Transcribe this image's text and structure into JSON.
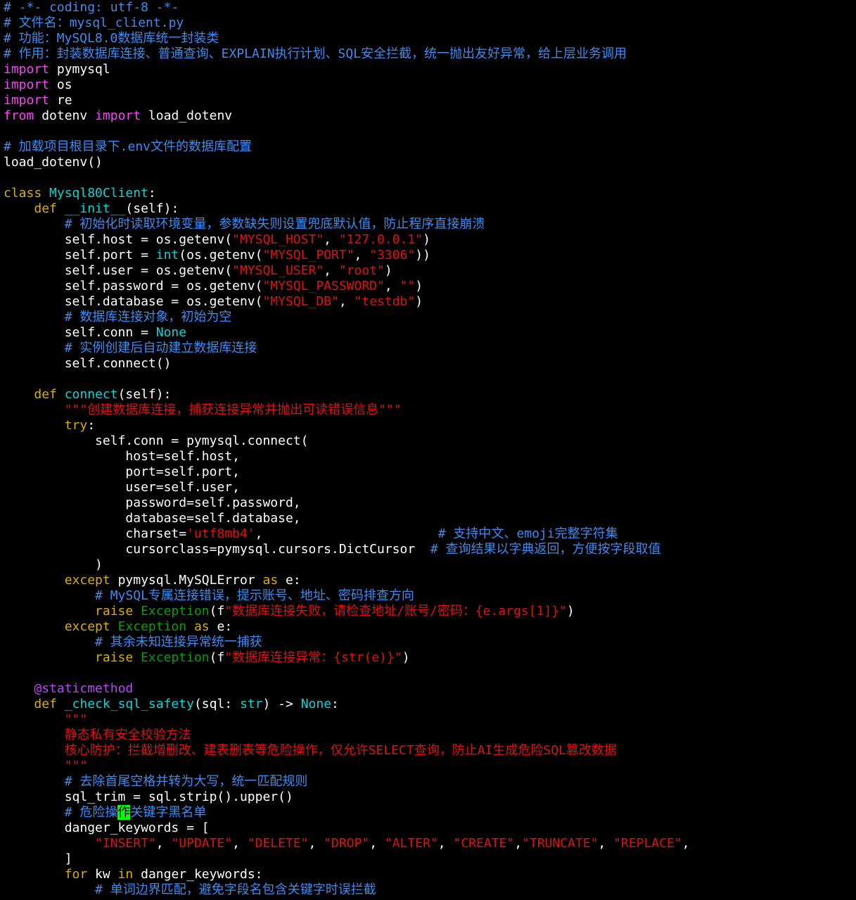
{
  "editor": {
    "lines": [
      [
        [
          "comment",
          "# -*- coding: utf-8 -*-"
        ]
      ],
      [
        [
          "comment",
          "# 文件名："
        ],
        [
          "comment",
          "mysql_client.py"
        ]
      ],
      [
        [
          "comment",
          "# 功能：MySQL8.0数据库统一封装类"
        ]
      ],
      [
        [
          "comment",
          "# 作用：封装数据库连接、普通查询、EXPLAIN执行计划、SQL安全拦截，统一抛出友好异常，给上层业务调用"
        ]
      ],
      [
        [
          "kw",
          "import"
        ],
        [
          "plain",
          " pymysql"
        ]
      ],
      [
        [
          "kw",
          "import"
        ],
        [
          "plain",
          " os"
        ]
      ],
      [
        [
          "kw",
          "import"
        ],
        [
          "plain",
          " re"
        ]
      ],
      [
        [
          "kw",
          "from"
        ],
        [
          "plain",
          " dotenv "
        ],
        [
          "kw",
          "import"
        ],
        [
          "plain",
          " load_dotenv"
        ]
      ],
      [],
      [
        [
          "comment",
          "# 加载项目根目录下.env文件的数据库配置"
        ]
      ],
      [
        [
          "plain",
          "load_dotenv()"
        ]
      ],
      [],
      [
        [
          "def",
          "class"
        ],
        [
          "plain",
          " "
        ],
        [
          "fn",
          "Mysql80Client"
        ],
        [
          "plain",
          ":"
        ]
      ],
      [
        [
          "plain",
          "    "
        ],
        [
          "def",
          "def"
        ],
        [
          "plain",
          " "
        ],
        [
          "fn",
          "__init__"
        ],
        [
          "plain",
          "(self):"
        ]
      ],
      [
        [
          "plain",
          "        "
        ],
        [
          "comment",
          "# 初始化时读取环境变量，参数缺失则设置兜底默认值，防止程序直接崩溃"
        ]
      ],
      [
        [
          "plain",
          "        self.host = os.getenv("
        ],
        [
          "str",
          "\"MYSQL_HOST\""
        ],
        [
          "plain",
          ", "
        ],
        [
          "str",
          "\"127.0.0.1\""
        ],
        [
          "plain",
          ")"
        ]
      ],
      [
        [
          "plain",
          "        self.port = "
        ],
        [
          "fn",
          "int"
        ],
        [
          "plain",
          "(os.getenv("
        ],
        [
          "str",
          "\"MYSQL_PORT\""
        ],
        [
          "plain",
          ", "
        ],
        [
          "str",
          "\"3306\""
        ],
        [
          "plain",
          "))"
        ]
      ],
      [
        [
          "plain",
          "        self.user = os.getenv("
        ],
        [
          "str",
          "\"MYSQL_USER\""
        ],
        [
          "plain",
          ", "
        ],
        [
          "str",
          "\"root\""
        ],
        [
          "plain",
          ")"
        ]
      ],
      [
        [
          "plain",
          "        self.password = os.getenv("
        ],
        [
          "str",
          "\"MYSQL_PASSWORD\""
        ],
        [
          "plain",
          ", "
        ],
        [
          "str",
          "\"\""
        ],
        [
          "plain",
          ")"
        ]
      ],
      [
        [
          "plain",
          "        self.database = os.getenv("
        ],
        [
          "str",
          "\"MYSQL_DB\""
        ],
        [
          "plain",
          ", "
        ],
        [
          "str",
          "\"testdb\""
        ],
        [
          "plain",
          ")"
        ]
      ],
      [
        [
          "plain",
          "        "
        ],
        [
          "comment",
          "# 数据库连接对象，初始为空"
        ]
      ],
      [
        [
          "plain",
          "        self.conn = "
        ],
        [
          "const",
          "None"
        ]
      ],
      [
        [
          "plain",
          "        "
        ],
        [
          "comment",
          "# 实例创建后自动建立数据库连接"
        ]
      ],
      [
        [
          "plain",
          "        self.connect()"
        ]
      ],
      [],
      [
        [
          "plain",
          "    "
        ],
        [
          "def",
          "def"
        ],
        [
          "plain",
          " "
        ],
        [
          "fn",
          "connect"
        ],
        [
          "plain",
          "(self):"
        ]
      ],
      [
        [
          "plain",
          "        "
        ],
        [
          "str",
          "\"\"\"创建数据库连接，捕获连接异常并抛出可读错误信息\"\"\""
        ]
      ],
      [
        [
          "plain",
          "        "
        ],
        [
          "def",
          "try"
        ],
        [
          "plain",
          ":"
        ]
      ],
      [
        [
          "plain",
          "            self.conn = pymysql.connect("
        ]
      ],
      [
        [
          "plain",
          "                host=self.host,"
        ]
      ],
      [
        [
          "plain",
          "                port=self.port,"
        ]
      ],
      [
        [
          "plain",
          "                user=self.user,"
        ]
      ],
      [
        [
          "plain",
          "                password=self.password,"
        ]
      ],
      [
        [
          "plain",
          "                database=self.database,"
        ]
      ],
      [
        [
          "plain",
          "                charset="
        ],
        [
          "str",
          "'utf8mb4'"
        ],
        [
          "plain",
          ",                       "
        ],
        [
          "comment",
          "# 支持中文、emoji完整字符集"
        ]
      ],
      [
        [
          "plain",
          "                cursorclass=pymysql.cursors.DictCursor  "
        ],
        [
          "comment",
          "# 查询结果以字典返回，方便按字段取值"
        ]
      ],
      [
        [
          "plain",
          "            )"
        ]
      ],
      [
        [
          "plain",
          "        "
        ],
        [
          "def",
          "except"
        ],
        [
          "plain",
          " pymysql.MySQLError "
        ],
        [
          "def",
          "as"
        ],
        [
          "plain",
          " e:"
        ]
      ],
      [
        [
          "plain",
          "            "
        ],
        [
          "comment",
          "# MySQL专属连接错误，提示账号、地址、密码排查方向"
        ]
      ],
      [
        [
          "plain",
          "            "
        ],
        [
          "def",
          "raise"
        ],
        [
          "plain",
          " "
        ],
        [
          "exc",
          "Exception"
        ],
        [
          "plain",
          "(f"
        ],
        [
          "str",
          "\"数据库连接失败，请检查地址/账号/密码：{e.args[1]}\""
        ],
        [
          "plain",
          ")"
        ]
      ],
      [
        [
          "plain",
          "        "
        ],
        [
          "def",
          "except"
        ],
        [
          "plain",
          " "
        ],
        [
          "exc",
          "Exception"
        ],
        [
          "plain",
          " "
        ],
        [
          "def",
          "as"
        ],
        [
          "plain",
          " e:"
        ]
      ],
      [
        [
          "plain",
          "            "
        ],
        [
          "comment",
          "# 其余未知连接异常统一捕获"
        ]
      ],
      [
        [
          "plain",
          "            "
        ],
        [
          "def",
          "raise"
        ],
        [
          "plain",
          " "
        ],
        [
          "exc",
          "Exception"
        ],
        [
          "plain",
          "(f"
        ],
        [
          "str",
          "\"数据库连接异常：{str(e)}\""
        ],
        [
          "plain",
          ")"
        ]
      ],
      [],
      [
        [
          "plain",
          "    "
        ],
        [
          "dec",
          "@staticmethod"
        ]
      ],
      [
        [
          "plain",
          "    "
        ],
        [
          "def",
          "def"
        ],
        [
          "plain",
          " "
        ],
        [
          "fn",
          "_check_sql_safety"
        ],
        [
          "plain",
          "(sql: "
        ],
        [
          "fn",
          "str"
        ],
        [
          "plain",
          ") -> "
        ],
        [
          "const",
          "None"
        ],
        [
          "plain",
          ":"
        ]
      ],
      [
        [
          "plain",
          "        "
        ],
        [
          "str",
          "\"\"\""
        ]
      ],
      [
        [
          "plain",
          "        "
        ],
        [
          "str",
          "静态私有安全校验方法"
        ]
      ],
      [
        [
          "plain",
          "        "
        ],
        [
          "str",
          "核心防护：拦截增删改、建表删表等危险操作，仅允许SELECT查询，防止AI生成危险SQL篡改数据"
        ]
      ],
      [
        [
          "plain",
          "        "
        ],
        [
          "str",
          "\"\"\""
        ]
      ],
      [
        [
          "plain",
          "        "
        ],
        [
          "comment",
          "# 去除首尾空格并转为大写，统一匹配规则"
        ]
      ],
      [
        [
          "plain",
          "        sql_trim = sql.strip().upper()"
        ]
      ],
      [
        [
          "plain",
          "        "
        ],
        [
          "comment",
          "# 危险操"
        ],
        [
          "cursor",
          "作"
        ],
        [
          "comment",
          "关键字黑名单"
        ]
      ],
      [
        [
          "plain",
          "        danger_keywords = ["
        ]
      ],
      [
        [
          "plain",
          "            "
        ],
        [
          "str",
          "\"INSERT\""
        ],
        [
          "plain",
          ", "
        ],
        [
          "str",
          "\"UPDATE\""
        ],
        [
          "plain",
          ", "
        ],
        [
          "str",
          "\"DELETE\""
        ],
        [
          "plain",
          ", "
        ],
        [
          "str",
          "\"DROP\""
        ],
        [
          "plain",
          ", "
        ],
        [
          "str",
          "\"ALTER\""
        ],
        [
          "plain",
          ", "
        ],
        [
          "str",
          "\"CREATE\""
        ],
        [
          "plain",
          ","
        ],
        [
          "str",
          "\"TRUNCATE\""
        ],
        [
          "plain",
          ", "
        ],
        [
          "str",
          "\"REPLACE\""
        ],
        [
          "plain",
          ","
        ]
      ],
      [
        [
          "plain",
          "        ]"
        ]
      ],
      [
        [
          "plain",
          "        "
        ],
        [
          "def",
          "for"
        ],
        [
          "plain",
          " kw "
        ],
        [
          "def",
          "in"
        ],
        [
          "plain",
          " danger_keywords:"
        ]
      ],
      [
        [
          "plain",
          "            "
        ],
        [
          "comment",
          "# 单词边界匹配，避免字段名包含关键字时误拦截"
        ]
      ]
    ]
  }
}
